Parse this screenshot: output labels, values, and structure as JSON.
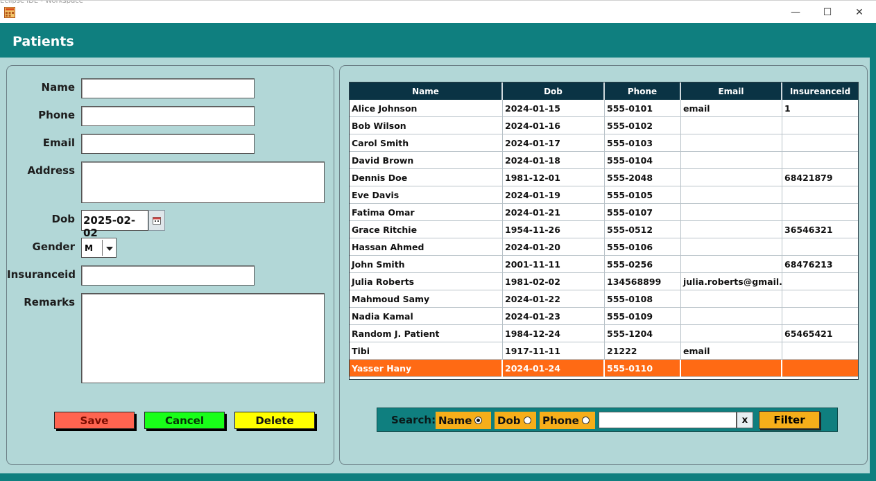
{
  "window": {
    "title": "",
    "faint_title": "Eclipse IDE - Workspace",
    "min_glyph": "—",
    "max_glyph": "☐",
    "close_glyph": "✕"
  },
  "header": {
    "title": "Patients"
  },
  "form": {
    "name_label": "Name",
    "phone_label": "Phone",
    "email_label": "Email",
    "address_label": "Address",
    "dob_label": "Dob",
    "dob_value": "2025-02-02",
    "gender_label": "Gender",
    "gender_value": "M",
    "insurance_label": "Insuranceid",
    "remarks_label": "Remarks",
    "save_label": "Save",
    "cancel_label": "Cancel",
    "delete_label": "Delete"
  },
  "table": {
    "columns": [
      "Name",
      "Dob",
      "Phone",
      "Email",
      "Insureanceid"
    ],
    "rows": [
      [
        "Alice Johnson",
        "2024-01-15",
        "555-0101",
        " email",
        "1"
      ],
      [
        "Bob Wilson",
        "2024-01-16",
        "555-0102",
        "",
        ""
      ],
      [
        "Carol Smith",
        "2024-01-17",
        "555-0103",
        "",
        ""
      ],
      [
        "David Brown",
        "2024-01-18",
        "555-0104",
        "",
        ""
      ],
      [
        "Dennis Doe",
        "1981-12-01",
        "555-2048",
        "",
        "68421879"
      ],
      [
        "Eve Davis",
        "2024-01-19",
        "555-0105",
        "",
        ""
      ],
      [
        "Fatima Omar",
        "2024-01-21",
        "555-0107",
        "",
        ""
      ],
      [
        "Grace Ritchie",
        "1954-11-26",
        "555-0512",
        "",
        "36546321"
      ],
      [
        "Hassan Ahmed",
        "2024-01-20",
        "555-0106",
        "",
        ""
      ],
      [
        "John Smith",
        "2001-11-11",
        "555-0256",
        "",
        "68476213"
      ],
      [
        "Julia Roberts",
        "1981-02-02",
        "134568899",
        "julia.roberts@gmail....",
        ""
      ],
      [
        "Mahmoud Samy",
        "2024-01-22",
        "555-0108",
        "",
        ""
      ],
      [
        "Nadia Kamal",
        "2024-01-23",
        "555-0109",
        "",
        ""
      ],
      [
        "Random J. Patient",
        " 1984-12-24",
        "555-1204",
        "",
        "65465421"
      ],
      [
        "Tibi",
        "1917-11-11",
        "21222",
        "email",
        ""
      ],
      [
        "Yasser Hany",
        "2024-01-24",
        "555-0110",
        "",
        ""
      ]
    ],
    "selected_row": "Yasser Hany"
  },
  "search": {
    "label": "Search:",
    "options": [
      "Name",
      "Dob",
      "Phone"
    ],
    "selected": "Name",
    "clear_label": "x",
    "filter_label": "Filter"
  },
  "colors": {
    "teal": "#0f7f7f",
    "panel_bg": "#b2d7d7",
    "header_bg": "#0a3344",
    "selected_row": "#ff6a14",
    "save": "#ff6450",
    "cancel": "#19ff19",
    "delete": "#ffff00",
    "search_option": "#f6ae1a"
  }
}
